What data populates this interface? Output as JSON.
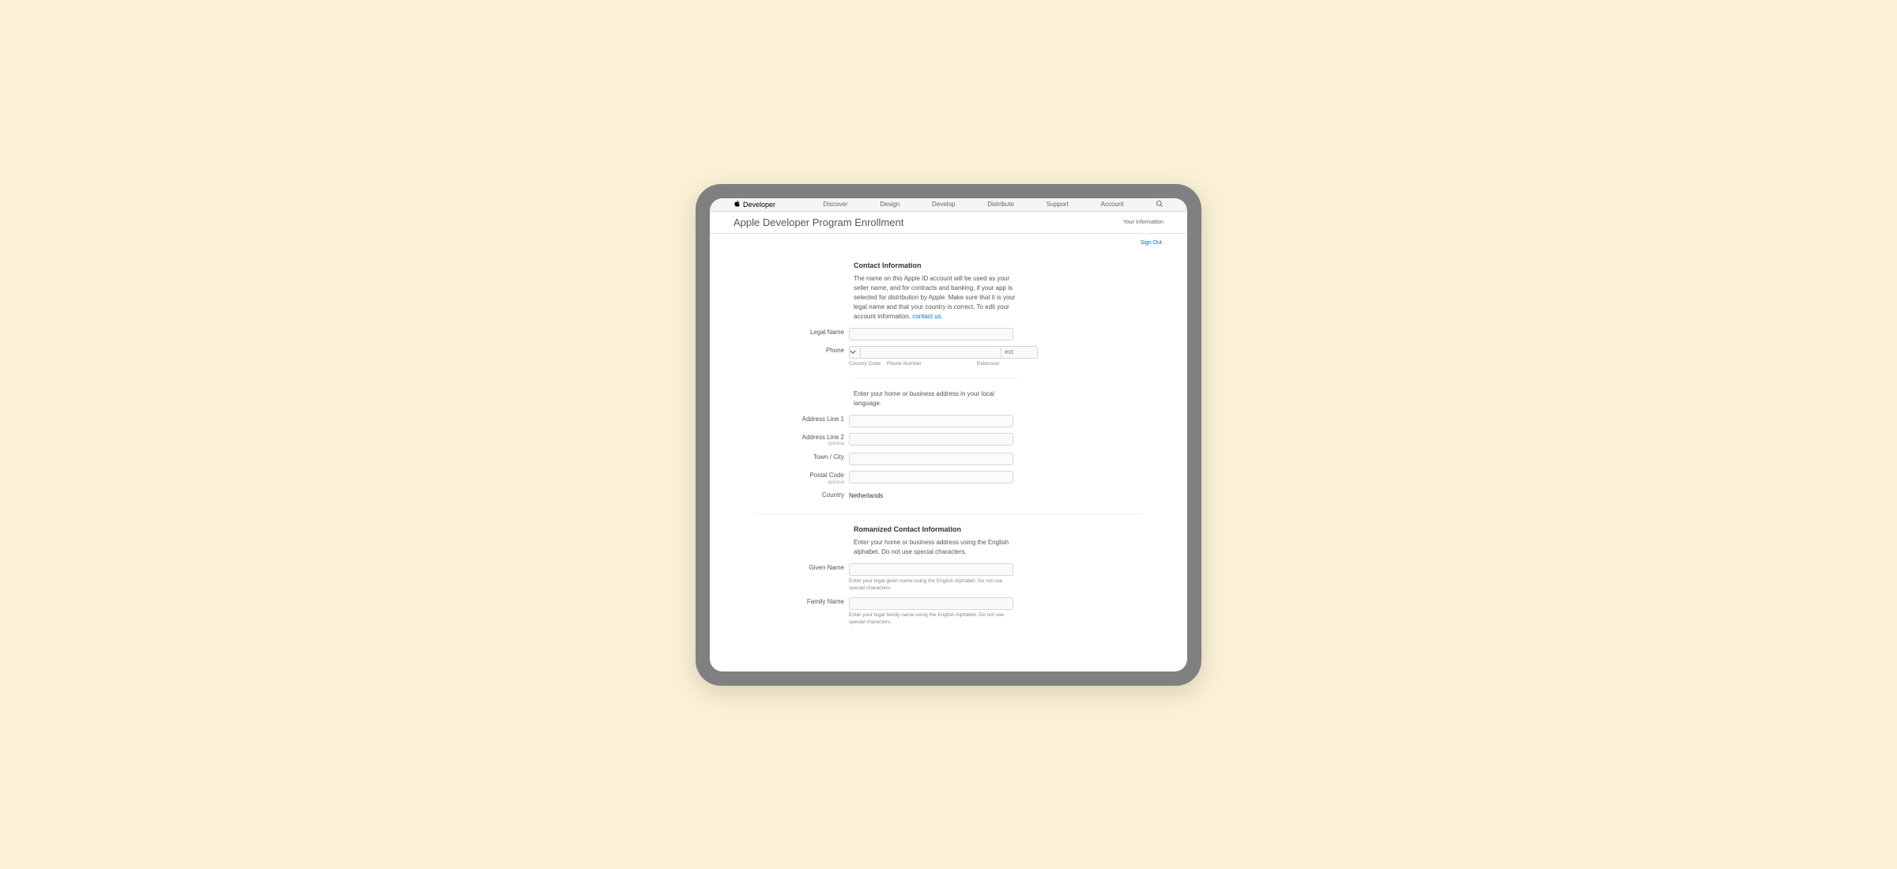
{
  "brand": {
    "name": "Developer"
  },
  "nav": [
    "Discover",
    "Design",
    "Develop",
    "Distribute",
    "Support",
    "Account"
  ],
  "subhead": {
    "title": "Apple Developer Program Enrollment",
    "right": "Your Information"
  },
  "signout": "Sign Out",
  "contact": {
    "title": "Contact Information",
    "intro": "The name on this Apple ID account will be used as your seller name, and for contracts and banking, if your app is selected for distribution by Apple. Make sure that it is your legal name and that your country is correct. To edit your account information, ",
    "contact_us": "contact us",
    "legal_name_label": "Legal Name",
    "phone_label": "Phone",
    "ext_placeholder": "ext",
    "sub": {
      "cc": "Country Code",
      "pn": "Phone Number",
      "ext": "Extension"
    },
    "addr_intro": "Enter your home or business address in your local language.",
    "addr1_label": "Address Line 1",
    "addr2_label": "Address Line 2",
    "optional": "optional",
    "city_label": "Town / City",
    "postal_label": "Postal Code",
    "country_label": "Country",
    "country_value": "Netherlands"
  },
  "roman": {
    "title": "Romanized Contact Information",
    "intro": "Enter your home or business address using the English alphabet. Do not use special characters.",
    "given_label": "Given Name",
    "given_hint": "Enter your legal given name using the English Alphabet. Do not use special characters.",
    "family_label": "Family Name",
    "family_hint": "Enter your legal family name using the English Alphabet. Do not use special characters."
  }
}
